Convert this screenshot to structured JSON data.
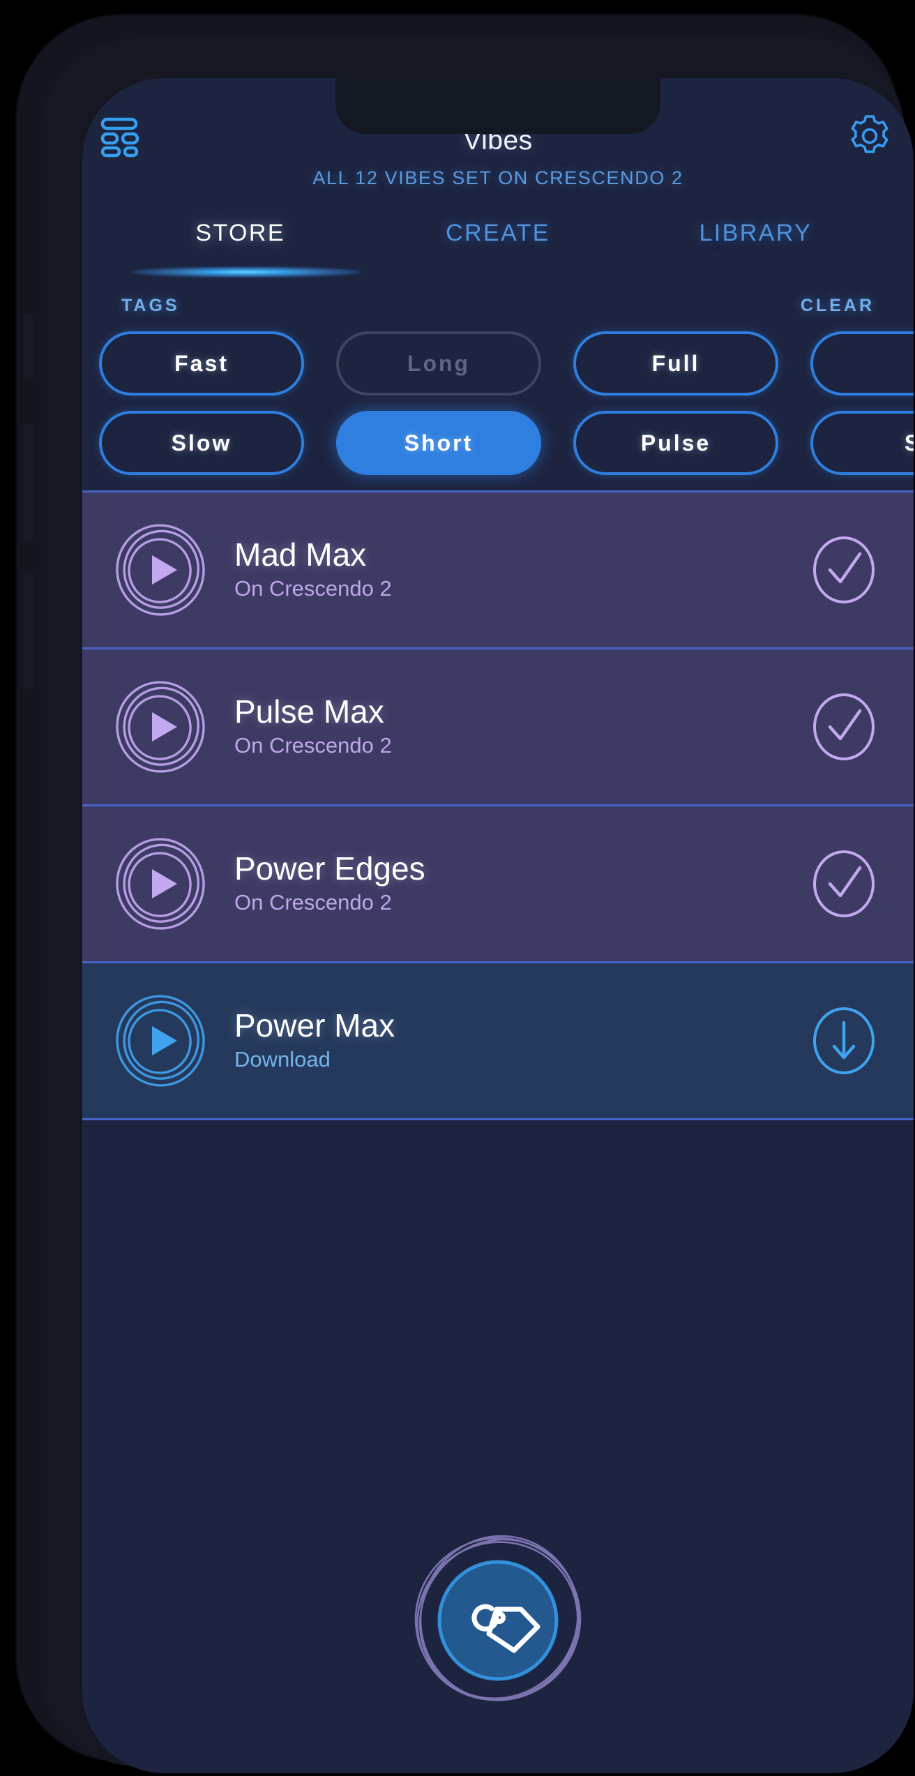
{
  "app": {
    "title": "Vibes",
    "subtitle": "ALL 12 VIBES SET ON CRESCENDO 2",
    "menu_icon": "list-menu-icon",
    "settings_icon": "gear-icon"
  },
  "colors": {
    "screen_bg": "#1d2440",
    "accent_blue": "#2f7fe0",
    "glow_cyan": "#6ee0ff",
    "tab_inactive": "#4f93dd",
    "tab_active": "#ffffff",
    "row_purple": "#3d3a63",
    "row_blue": "#25395c",
    "row_divider": "#4763c9",
    "purple_icon": "#c3a9ef",
    "blue_icon": "#3fa3ef",
    "chip_disabled": "#5d6685"
  },
  "tabs": [
    {
      "label": "STORE",
      "active": true
    },
    {
      "label": "CREATE",
      "active": false
    },
    {
      "label": "LIBRARY",
      "active": false
    }
  ],
  "tag_section": {
    "tags_label": "TAGS",
    "clear_label": "CLEAR",
    "rows": [
      [
        {
          "label": "Fast",
          "state": "available"
        },
        {
          "label": "Long",
          "state": "disabled"
        },
        {
          "label": "Full",
          "state": "available"
        },
        {
          "label": "",
          "state": "available"
        }
      ],
      [
        {
          "label": "Slow",
          "state": "available"
        },
        {
          "label": "Short",
          "state": "selected"
        },
        {
          "label": "Pulse",
          "state": "available"
        },
        {
          "label": "S",
          "state": "available"
        }
      ]
    ]
  },
  "vibes": [
    {
      "name": "Mad Max",
      "status": "On Crescendo 2",
      "theme": "purple",
      "action": "check-icon"
    },
    {
      "name": "Pulse Max",
      "status": "On Crescendo 2",
      "theme": "purple",
      "action": "check-icon"
    },
    {
      "name": "Power Edges",
      "status": "On Crescendo 2",
      "theme": "purple",
      "action": "check-icon"
    },
    {
      "name": "Power Max",
      "status": "Download",
      "theme": "blue",
      "action": "download-icon"
    }
  ],
  "fab": {
    "icon": "tag-icon",
    "label": "Tags"
  }
}
